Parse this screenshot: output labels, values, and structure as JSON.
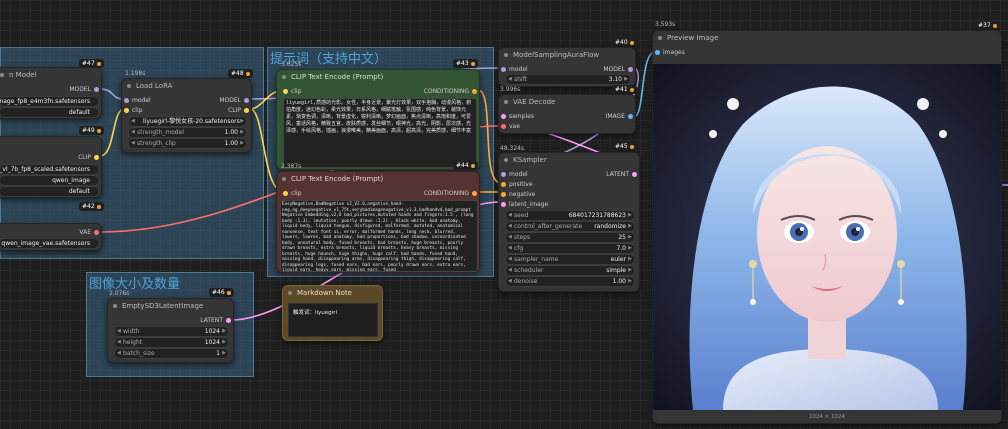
{
  "groups": {
    "prompt_title": "提示词（支持中文）",
    "size_title": "图像大小及数量"
  },
  "model_node": {
    "title": "n Model",
    "id": "#47",
    "output": "MODEL",
    "widgets": [
      "image_fp8_e4m3fn.safetensors",
      "default"
    ]
  },
  "clip_node": {
    "id": "#49",
    "output": "CLIP",
    "widgets": [
      "_vl_7b_fp8_scaled.safetensors",
      "qwen_image",
      "default"
    ]
  },
  "vae_node": {
    "id": "#42",
    "output": "VAE",
    "widgets": [
      "qwen_image_vae.safetensors"
    ]
  },
  "lora_node": {
    "time": "1.198s",
    "id": "#48",
    "title": "Load LoRA",
    "inputs": [
      "model",
      "clip"
    ],
    "outputs": [
      "MODEL",
      "CLIP"
    ],
    "lora_name": "liyuegirl-黎悦女孩-20.safetensors",
    "widgets": [
      {
        "label": "strength_model",
        "value": "1.00"
      },
      {
        "label": "strength_clip",
        "value": "1.00"
      }
    ]
  },
  "pos_clip": {
    "time": "3.025s",
    "id": "#43",
    "title": "CLIP Text Encode (Prompt)",
    "input": "clip",
    "output": "CONDITIONING",
    "text": "liyuegirl,质感的光影。女性，半身近景，聚光灯效果，双手抱胸，动漫风格，俯拍角度，迷幻色彩，柔光效果，日系风格，细腻笔触，氛围感，纯色背景，装饰元素，渐变色调，清晰，背景虚化，锐利清晰，梦幻画面，焦点清晰，高饱和度，可爱风，童话风格，精致五官，皮肤质感，发丝细节，眼神光，高光，阴影，层次感，光泽感，手绘风格，插画，浪漫唯美，精美画面，高清，超高清，完美质感，细节丰富"
  },
  "neg_clip": {
    "time": "2.387s",
    "id": "#44",
    "title": "CLIP Text Encode (Prompt)",
    "input": "clip",
    "output": "CONDITIONING",
    "text": "EasyNegative,BadNegative v2_V2.0,negative_hand-neg,ng_deepnegative_v1_75t,verybadimagenegative_v1.3,badhandv4,bad_prompt Negative Embedding,v2,6 bad_pictures,mutated hands and fingers:1.5 , (long body :1.3), (mutation, poorly drawn :1.2) , black-white, bad anatomy, liquid body, liquid tongue, disfigured, malformed, mutated, anatomical nonsense, text font ui, error, malformed hands, long neck, blurred, lowers, lowres, bad anatomy, bad proportions, bad shadow, uncoordinated body, unnatural body, fused breasts, bad breasts, huge breasts, poorly drawn breasts, extra breasts, liquid breasts, heavy breasts, missing breasts, huge haunch, huge thighs, huge calf, bad hands, fused hand, missing hand, disappearing arms, disappearing thigh, disappearing calf, disappearing legs, fused ears, bad ears, poorly drawn ears, extra ears, liquid ears, heavy ears, missing ears, fused"
  },
  "empty_latent": {
    "time": "2.076s",
    "id": "#46",
    "title": "EmptySD3LatentImage",
    "output": "LATENT",
    "widgets": [
      {
        "label": "width",
        "value": "1024"
      },
      {
        "label": "height",
        "value": "1024"
      },
      {
        "label": "batch_size",
        "value": "1"
      }
    ]
  },
  "markdown_note": {
    "title": "Markdown Note",
    "text": "触发词：liyuegirl"
  },
  "sampling_aura": {
    "id": "#40",
    "title": "ModelSamplingAuraFlow",
    "input": "model",
    "output": "MODEL",
    "shift_label": "shift",
    "shift_value": "3.10"
  },
  "vae_decode": {
    "id": "#41",
    "time": "3.996s",
    "title": "VAE Decode",
    "inputs": [
      "samples",
      "vae"
    ],
    "output": "IMAGE"
  },
  "ksampler": {
    "time": "48.324s",
    "id": "#45",
    "title": "KSampler",
    "inputs": [
      "model",
      "positive",
      "negative",
      "latent_image"
    ],
    "output": "LATENT",
    "widgets": [
      {
        "label": "seed",
        "value": "684017231788623"
      },
      {
        "label": "control_after_generate",
        "value": "randomize"
      },
      {
        "label": "steps",
        "value": "25"
      },
      {
        "label": "cfg",
        "value": "7.0"
      },
      {
        "label": "sampler_name",
        "value": "euler"
      },
      {
        "label": "scheduler",
        "value": "simple"
      },
      {
        "label": "denoise",
        "value": "1.00"
      }
    ]
  },
  "preview": {
    "time": "3.593s",
    "id": "#37",
    "title": "Preview Image",
    "input": "images",
    "size_caption": "1024 × 1024"
  },
  "colors": {
    "model": "#b39ddb",
    "clip": "#ffd54f",
    "vae": "#ff6e6e",
    "conditioning": "#ffa931",
    "latent": "#ff9cf9",
    "image": "#64b5f6",
    "pos_node": "#335533",
    "neg_node": "#553333",
    "note": "#5a4a2a"
  }
}
